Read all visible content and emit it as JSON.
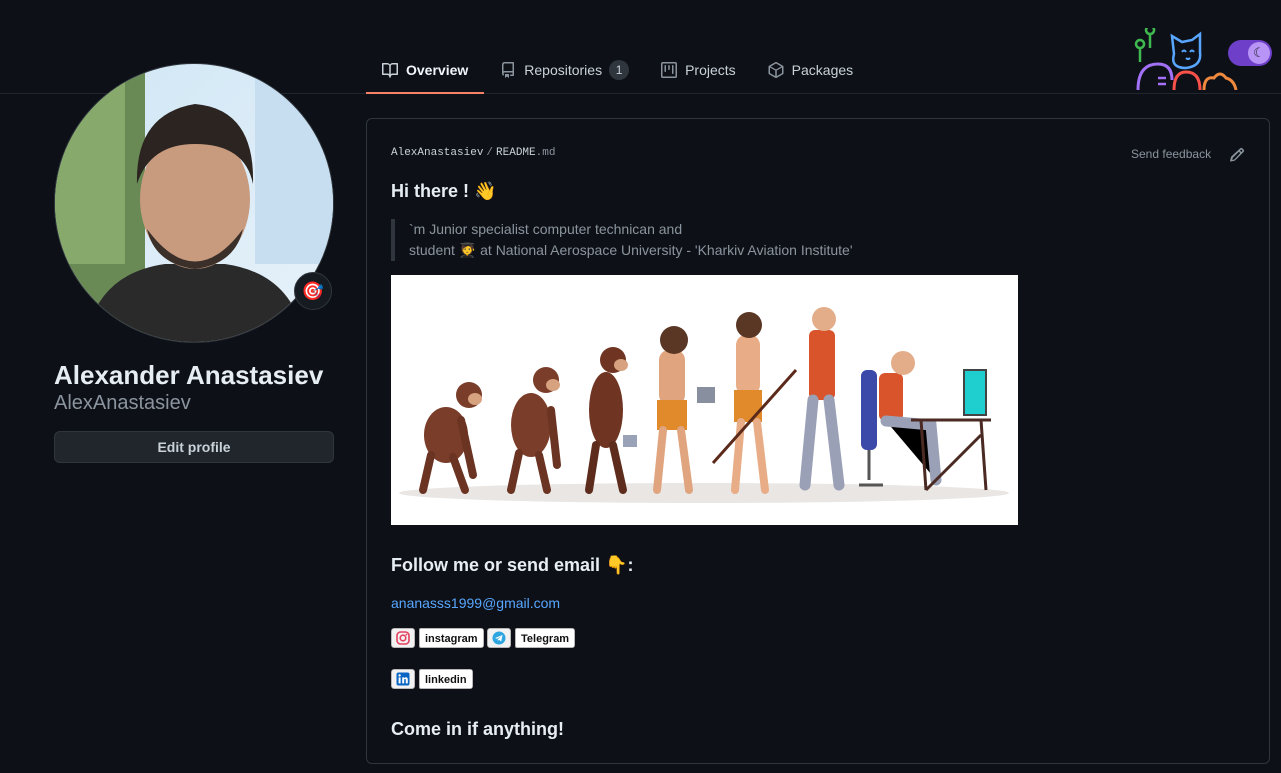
{
  "nav": {
    "tabs": [
      {
        "label": "Overview",
        "icon": "book-icon",
        "active": true
      },
      {
        "label": "Repositories",
        "icon": "repo-icon",
        "count": "1"
      },
      {
        "label": "Projects",
        "icon": "project-icon"
      },
      {
        "label": "Packages",
        "icon": "package-icon"
      }
    ],
    "theme_toggle_icon": "moon-icon"
  },
  "profile": {
    "full_name": "Alexander Anastasiev",
    "username": "AlexAnastasiev",
    "edit_button": "Edit profile",
    "status_icon": "target-icon"
  },
  "readme": {
    "owner": "AlexAnastasiev",
    "separator": "/",
    "file_name": "README",
    "file_ext": ".md",
    "send_feedback": "Send feedback",
    "heading": "Hi there ! 👋",
    "quote_line1": "`m Junior specialist computer technican and",
    "quote_line2": "student 🧑‍🎓 at National Aerospace University - 'Kharkiv Aviation Institute'",
    "follow_heading": "Follow me or send email 👇:",
    "email": "ananasss1999@gmail.com",
    "badges": [
      {
        "label": "instagram",
        "icon": "instagram-icon",
        "color": "#e4405f"
      },
      {
        "label": "Telegram",
        "icon": "telegram-icon",
        "color": "#2ca5e0"
      },
      {
        "label": "linkedin",
        "icon": "linkedin-icon",
        "color": "#0a66c2"
      }
    ],
    "closing": "Come in if anything!"
  },
  "colors": {
    "background": "#0d1117",
    "active_tab_underline": "#f78166",
    "link": "#58a6ff",
    "toggle": "#6e40c9"
  }
}
